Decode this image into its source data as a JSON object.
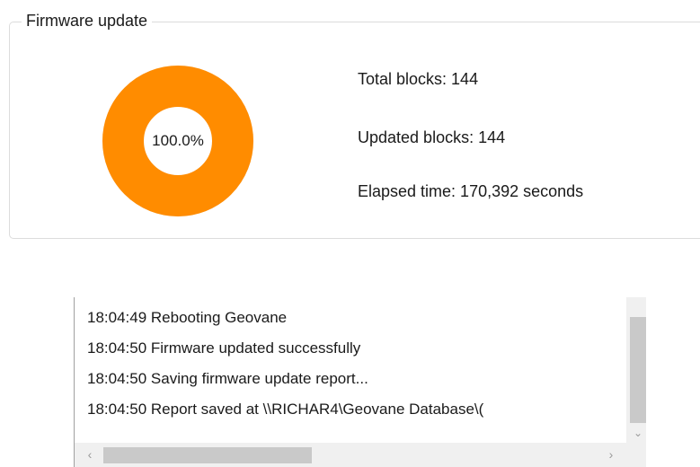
{
  "firmware_update": {
    "title": "Firmware update",
    "progress": {
      "percent_label": "100.0%",
      "fraction": 1.0,
      "ring_color": "#FF8C00"
    },
    "total_blocks": "Total blocks: 144",
    "updated_blocks": "Updated blocks: 144",
    "elapsed_time": "Elapsed time: 170,392 seconds"
  },
  "log": {
    "lines": [
      "18:04:49 Rebooting Geovane",
      "18:04:50 Firmware updated successfully",
      "18:04:50 Saving firmware update report...",
      "18:04:50 Report saved at \\\\RICHAR4\\Geovane Database\\("
    ],
    "scroll_down_icon": "chevron-down-icon",
    "scroll_left_icon": "chevron-left-icon",
    "scroll_right_icon": "chevron-right-icon"
  }
}
